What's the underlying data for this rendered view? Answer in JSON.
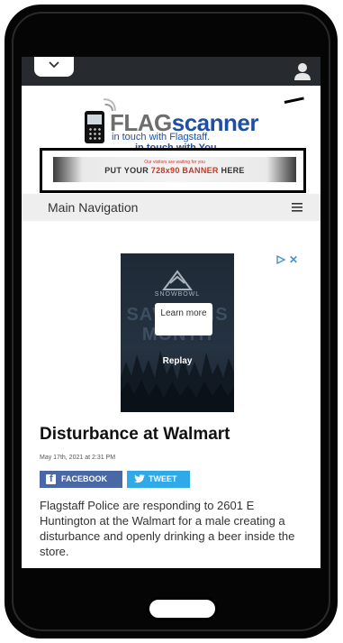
{
  "site": {
    "logo_brand_a": "FLAG",
    "logo_brand_b": "scanner",
    "tagline_1": "in touch with Flagstaff.",
    "tagline_2": "in touch with You."
  },
  "banner": {
    "small_text": "Our visitors are waiting for you",
    "text_before": "PUT YOUR ",
    "text_highlight": "728x90 BANNER",
    "text_after": " HERE"
  },
  "nav": {
    "label": "Main Navigation"
  },
  "ad": {
    "brand": "SNOWBOWL",
    "bg_text": "SAVE THIS MONTH",
    "learn_more": "Learn more",
    "replay": "Replay"
  },
  "article": {
    "title": "Disturbance at Walmart",
    "date": "May 17th, 2021 at 2:31 PM",
    "share_facebook": "FACEBOOK",
    "share_tweet": "TWEET",
    "body": "Flagstaff Police are responding to 2601 E Huntington at the Walmart for a male creating a disturbance and openly drinking a beer inside the store."
  },
  "colors": {
    "topbar": "#272a2e",
    "brand_blue": "#1f4fa3",
    "facebook": "#4a67a6",
    "twitter": "#2fa9e8"
  }
}
